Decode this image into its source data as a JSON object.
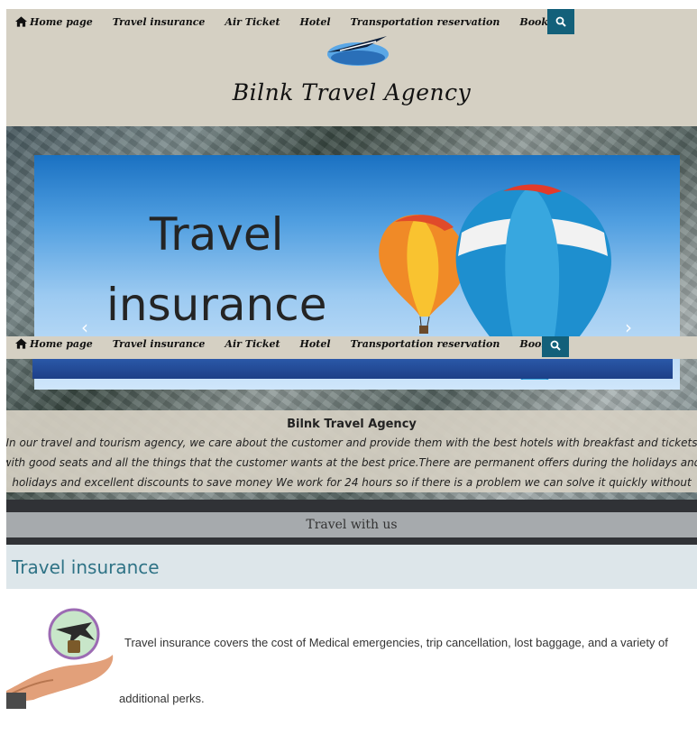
{
  "nav": {
    "items": [
      "Home page",
      "Travel insurance",
      "Air Ticket",
      "Hotel",
      "Transportation reservation",
      "Booking"
    ]
  },
  "brand": {
    "name": "Bilnk Travel Agency"
  },
  "hero": {
    "slide_text_line1": "Travel",
    "slide_text_line2": "insurance"
  },
  "about": {
    "title": "Bilnk Travel Agency",
    "text": "In our travel and tourism agency, we care about the customer and provide them with the best hotels with breakfast and tickets with good seats and all the things that the customer wants at the best price.There are permanent offers during the holidays and holidays and excellent discounts to save money We work for 24 hours so if there is a problem we can solve it quickly without delay."
  },
  "banner": {
    "label": "Travel with us"
  },
  "section": {
    "title": "Travel insurance",
    "description_line1": "Travel insurance covers the cost of Medical emergencies, trip cancellation, lost baggage, and a variety of",
    "description_line2": "additional perks."
  },
  "colors": {
    "header_bg": "#d5d0c3",
    "search_button": "#13607a",
    "dark_bar": "#303236",
    "banner_bg": "#a6aaad",
    "section_head_bg": "#dde6ea",
    "section_title": "#2f7386"
  },
  "icons": [
    "home-icon",
    "search-icon",
    "plane-logo-icon",
    "chevron-left-icon",
    "chevron-right-icon",
    "insurance-hand-icon"
  ]
}
